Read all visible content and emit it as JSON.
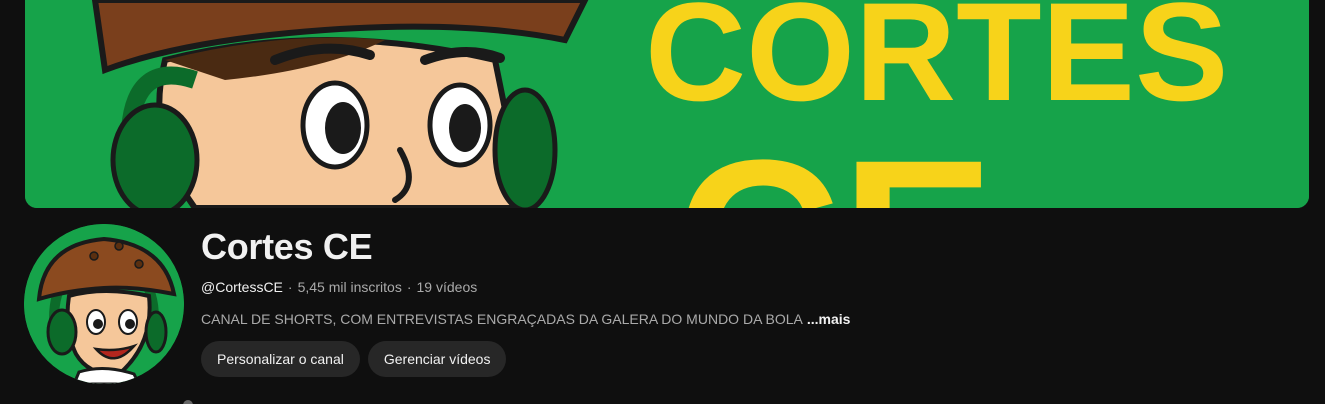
{
  "banner": {
    "text_top": "CORTES",
    "text_bottom": "CE",
    "bg_color": "#16a34a",
    "text_color": "#f7d31a"
  },
  "channel": {
    "name": "Cortes CE",
    "handle": "@CortessCE",
    "subscribers": "5,45 mil inscritos",
    "videos": "19 vídeos",
    "separator": "·",
    "description": "CANAL DE SHORTS, COM ENTREVISTAS ENGRAÇADAS DA GALERA DO MUNDO DA BOLA",
    "more_label": "...mais"
  },
  "actions": {
    "customize_label": "Personalizar o canal",
    "manage_label": "Gerenciar vídeos"
  },
  "colors": {
    "background": "#0f0f0f",
    "button_bg": "#272727",
    "text_primary": "#f1f1f1",
    "text_secondary": "#aaaaaa"
  }
}
